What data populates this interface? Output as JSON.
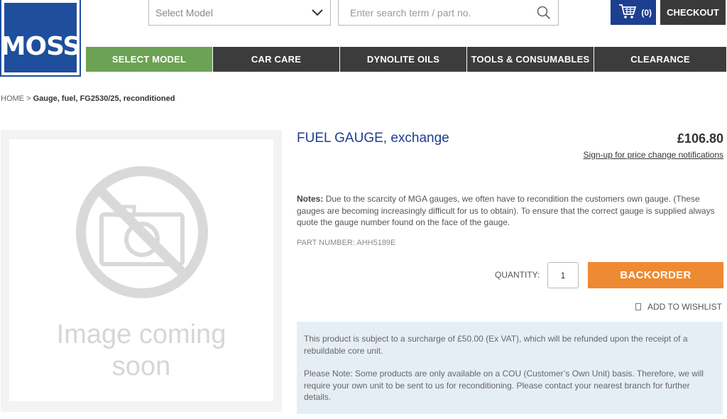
{
  "logo": {
    "text": "MOSS"
  },
  "header": {
    "model_select": {
      "placeholder": "Select Model"
    },
    "search": {
      "placeholder": "Enter search term / part no."
    },
    "cart": {
      "count": "(0)"
    },
    "checkout_label": "CHECKOUT"
  },
  "nav": {
    "items": [
      {
        "label": "SELECT MODEL",
        "active": true
      },
      {
        "label": "CAR CARE"
      },
      {
        "label": "DYNOLITE OILS"
      },
      {
        "label": "TOOLS & CONSUMABLES"
      },
      {
        "label": "CLEARANCE"
      }
    ]
  },
  "breadcrumb": {
    "home": "HOME",
    "separator": ">",
    "current": "Gauge, fuel, FG2530/25, reconditioned"
  },
  "product": {
    "image_placeholder": {
      "line1": "Image coming",
      "line2": "soon"
    },
    "title": "FUEL GAUGE, exchange",
    "price": "£106.80",
    "price_notify": "Sign-up for price change notifications",
    "notes_label": "Notes:",
    "notes_text": "Due to the scarcity of MGA gauges, we often have to recondition the customers own gauge. (These gauges are becoming increasingly difficult for us to obtain). To ensure that the correct gauge is supplied always quote the gauge number found on the face of the gauge.",
    "part_number": "PART NUMBER: AHH5189E",
    "quantity_label": "QUANTITY:",
    "quantity_value": "1",
    "backorder_label": "BACKORDER",
    "wishlist_label": "ADD TO WISHLIST",
    "surcharge_text": "This product is subject to a surcharge of £50.00 (Ex VAT), which will be refunded upon the receipt of a rebuildable core unit.",
    "cou_note": "Please Note: Some products are only available on a COU (Customer’s Own Unit) basis. Therefore, we will require your own unit to be sent to us for reconditioning. Please contact your nearest branch for further details."
  },
  "colors": {
    "brand_blue": "#1f4e9c",
    "nav_dark": "#3c3c3c",
    "nav_active": "#6ba253",
    "backorder": "#ee8a31",
    "info_panel": "#e6eef5"
  }
}
